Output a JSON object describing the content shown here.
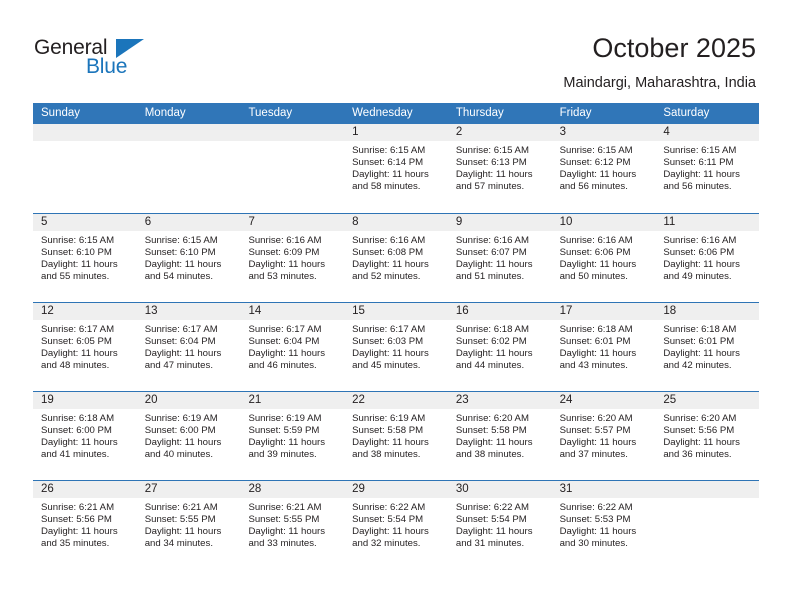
{
  "brand": {
    "name_top": "General",
    "name_bottom": "Blue",
    "triangle_color": "#1b75bb",
    "text_color": "#231f20"
  },
  "header": {
    "title": "October 2025",
    "subtitle": "Maindargi, Maharashtra, India"
  },
  "theme": {
    "header_blue": "#3076b8",
    "week_rule_blue": "#2e74b5",
    "day_strip_gray": "#efefef",
    "text": "#231f20"
  },
  "weekdays": [
    "Sunday",
    "Monday",
    "Tuesday",
    "Wednesday",
    "Thursday",
    "Friday",
    "Saturday"
  ],
  "weeks": [
    [
      {
        "day": "",
        "sunrise": "",
        "sunset": "",
        "daylight_1": "",
        "daylight_2": "",
        "empty": true
      },
      {
        "day": "",
        "sunrise": "",
        "sunset": "",
        "daylight_1": "",
        "daylight_2": "",
        "empty": true
      },
      {
        "day": "",
        "sunrise": "",
        "sunset": "",
        "daylight_1": "",
        "daylight_2": "",
        "empty": true
      },
      {
        "day": "1",
        "sunrise": "Sunrise: 6:15 AM",
        "sunset": "Sunset: 6:14 PM",
        "daylight_1": "Daylight: 11 hours",
        "daylight_2": "and 58 minutes."
      },
      {
        "day": "2",
        "sunrise": "Sunrise: 6:15 AM",
        "sunset": "Sunset: 6:13 PM",
        "daylight_1": "Daylight: 11 hours",
        "daylight_2": "and 57 minutes."
      },
      {
        "day": "3",
        "sunrise": "Sunrise: 6:15 AM",
        "sunset": "Sunset: 6:12 PM",
        "daylight_1": "Daylight: 11 hours",
        "daylight_2": "and 56 minutes."
      },
      {
        "day": "4",
        "sunrise": "Sunrise: 6:15 AM",
        "sunset": "Sunset: 6:11 PM",
        "daylight_1": "Daylight: 11 hours",
        "daylight_2": "and 56 minutes."
      }
    ],
    [
      {
        "day": "5",
        "sunrise": "Sunrise: 6:15 AM",
        "sunset": "Sunset: 6:10 PM",
        "daylight_1": "Daylight: 11 hours",
        "daylight_2": "and 55 minutes."
      },
      {
        "day": "6",
        "sunrise": "Sunrise: 6:15 AM",
        "sunset": "Sunset: 6:10 PM",
        "daylight_1": "Daylight: 11 hours",
        "daylight_2": "and 54 minutes."
      },
      {
        "day": "7",
        "sunrise": "Sunrise: 6:16 AM",
        "sunset": "Sunset: 6:09 PM",
        "daylight_1": "Daylight: 11 hours",
        "daylight_2": "and 53 minutes."
      },
      {
        "day": "8",
        "sunrise": "Sunrise: 6:16 AM",
        "sunset": "Sunset: 6:08 PM",
        "daylight_1": "Daylight: 11 hours",
        "daylight_2": "and 52 minutes."
      },
      {
        "day": "9",
        "sunrise": "Sunrise: 6:16 AM",
        "sunset": "Sunset: 6:07 PM",
        "daylight_1": "Daylight: 11 hours",
        "daylight_2": "and 51 minutes."
      },
      {
        "day": "10",
        "sunrise": "Sunrise: 6:16 AM",
        "sunset": "Sunset: 6:06 PM",
        "daylight_1": "Daylight: 11 hours",
        "daylight_2": "and 50 minutes."
      },
      {
        "day": "11",
        "sunrise": "Sunrise: 6:16 AM",
        "sunset": "Sunset: 6:06 PM",
        "daylight_1": "Daylight: 11 hours",
        "daylight_2": "and 49 minutes."
      }
    ],
    [
      {
        "day": "12",
        "sunrise": "Sunrise: 6:17 AM",
        "sunset": "Sunset: 6:05 PM",
        "daylight_1": "Daylight: 11 hours",
        "daylight_2": "and 48 minutes."
      },
      {
        "day": "13",
        "sunrise": "Sunrise: 6:17 AM",
        "sunset": "Sunset: 6:04 PM",
        "daylight_1": "Daylight: 11 hours",
        "daylight_2": "and 47 minutes."
      },
      {
        "day": "14",
        "sunrise": "Sunrise: 6:17 AM",
        "sunset": "Sunset: 6:04 PM",
        "daylight_1": "Daylight: 11 hours",
        "daylight_2": "and 46 minutes."
      },
      {
        "day": "15",
        "sunrise": "Sunrise: 6:17 AM",
        "sunset": "Sunset: 6:03 PM",
        "daylight_1": "Daylight: 11 hours",
        "daylight_2": "and 45 minutes."
      },
      {
        "day": "16",
        "sunrise": "Sunrise: 6:18 AM",
        "sunset": "Sunset: 6:02 PM",
        "daylight_1": "Daylight: 11 hours",
        "daylight_2": "and 44 minutes."
      },
      {
        "day": "17",
        "sunrise": "Sunrise: 6:18 AM",
        "sunset": "Sunset: 6:01 PM",
        "daylight_1": "Daylight: 11 hours",
        "daylight_2": "and 43 minutes."
      },
      {
        "day": "18",
        "sunrise": "Sunrise: 6:18 AM",
        "sunset": "Sunset: 6:01 PM",
        "daylight_1": "Daylight: 11 hours",
        "daylight_2": "and 42 minutes."
      }
    ],
    [
      {
        "day": "19",
        "sunrise": "Sunrise: 6:18 AM",
        "sunset": "Sunset: 6:00 PM",
        "daylight_1": "Daylight: 11 hours",
        "daylight_2": "and 41 minutes."
      },
      {
        "day": "20",
        "sunrise": "Sunrise: 6:19 AM",
        "sunset": "Sunset: 6:00 PM",
        "daylight_1": "Daylight: 11 hours",
        "daylight_2": "and 40 minutes."
      },
      {
        "day": "21",
        "sunrise": "Sunrise: 6:19 AM",
        "sunset": "Sunset: 5:59 PM",
        "daylight_1": "Daylight: 11 hours",
        "daylight_2": "and 39 minutes."
      },
      {
        "day": "22",
        "sunrise": "Sunrise: 6:19 AM",
        "sunset": "Sunset: 5:58 PM",
        "daylight_1": "Daylight: 11 hours",
        "daylight_2": "and 38 minutes."
      },
      {
        "day": "23",
        "sunrise": "Sunrise: 6:20 AM",
        "sunset": "Sunset: 5:58 PM",
        "daylight_1": "Daylight: 11 hours",
        "daylight_2": "and 38 minutes."
      },
      {
        "day": "24",
        "sunrise": "Sunrise: 6:20 AM",
        "sunset": "Sunset: 5:57 PM",
        "daylight_1": "Daylight: 11 hours",
        "daylight_2": "and 37 minutes."
      },
      {
        "day": "25",
        "sunrise": "Sunrise: 6:20 AM",
        "sunset": "Sunset: 5:56 PM",
        "daylight_1": "Daylight: 11 hours",
        "daylight_2": "and 36 minutes."
      }
    ],
    [
      {
        "day": "26",
        "sunrise": "Sunrise: 6:21 AM",
        "sunset": "Sunset: 5:56 PM",
        "daylight_1": "Daylight: 11 hours",
        "daylight_2": "and 35 minutes."
      },
      {
        "day": "27",
        "sunrise": "Sunrise: 6:21 AM",
        "sunset": "Sunset: 5:55 PM",
        "daylight_1": "Daylight: 11 hours",
        "daylight_2": "and 34 minutes."
      },
      {
        "day": "28",
        "sunrise": "Sunrise: 6:21 AM",
        "sunset": "Sunset: 5:55 PM",
        "daylight_1": "Daylight: 11 hours",
        "daylight_2": "and 33 minutes."
      },
      {
        "day": "29",
        "sunrise": "Sunrise: 6:22 AM",
        "sunset": "Sunset: 5:54 PM",
        "daylight_1": "Daylight: 11 hours",
        "daylight_2": "and 32 minutes."
      },
      {
        "day": "30",
        "sunrise": "Sunrise: 6:22 AM",
        "sunset": "Sunset: 5:54 PM",
        "daylight_1": "Daylight: 11 hours",
        "daylight_2": "and 31 minutes."
      },
      {
        "day": "31",
        "sunrise": "Sunrise: 6:22 AM",
        "sunset": "Sunset: 5:53 PM",
        "daylight_1": "Daylight: 11 hours",
        "daylight_2": "and 30 minutes."
      },
      {
        "day": "",
        "sunrise": "",
        "sunset": "",
        "daylight_1": "",
        "daylight_2": "",
        "empty": true
      }
    ]
  ]
}
